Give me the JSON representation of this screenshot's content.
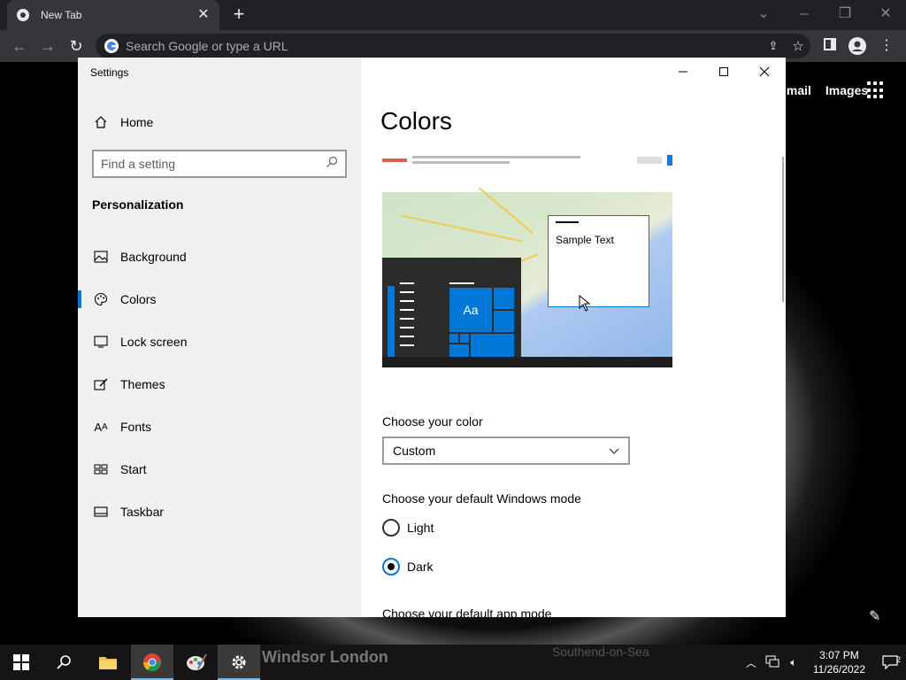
{
  "chrome": {
    "tab_title": "New Tab",
    "omnibox_placeholder": "Search Google or type a URL",
    "page_links": [
      "Gmail",
      "Images"
    ]
  },
  "settings": {
    "window_title": "Settings",
    "home_label": "Home",
    "search_placeholder": "Find a setting",
    "section": "Personalization",
    "nav": [
      {
        "label": "Background",
        "icon": "picture-icon"
      },
      {
        "label": "Colors",
        "icon": "palette-icon",
        "active": true
      },
      {
        "label": "Lock screen",
        "icon": "lock-screen-icon"
      },
      {
        "label": "Themes",
        "icon": "themes-icon"
      },
      {
        "label": "Fonts",
        "icon": "fonts-icon"
      },
      {
        "label": "Start",
        "icon": "start-icon"
      },
      {
        "label": "Taskbar",
        "icon": "taskbar-icon"
      }
    ],
    "content_title": "Colors",
    "preview_sample_text": "Sample Text",
    "preview_tile_text": "Aa",
    "choose_color_label": "Choose your color",
    "choose_color_value": "Custom",
    "windows_mode_label": "Choose your default Windows mode",
    "windows_mode_options": [
      "Light",
      "Dark"
    ],
    "windows_mode_selected": "Dark",
    "app_mode_label": "Choose your default app mode"
  },
  "taskbar": {
    "time": "3:07 PM",
    "date": "11/26/2022",
    "notification_count": "2",
    "bg_text": "Windsor London",
    "bg_text2": "Southend-on-Sea"
  },
  "colors": {
    "accent": "#0078d7",
    "chrome_dark": "#202124",
    "chrome_toolbar": "#35363a"
  }
}
